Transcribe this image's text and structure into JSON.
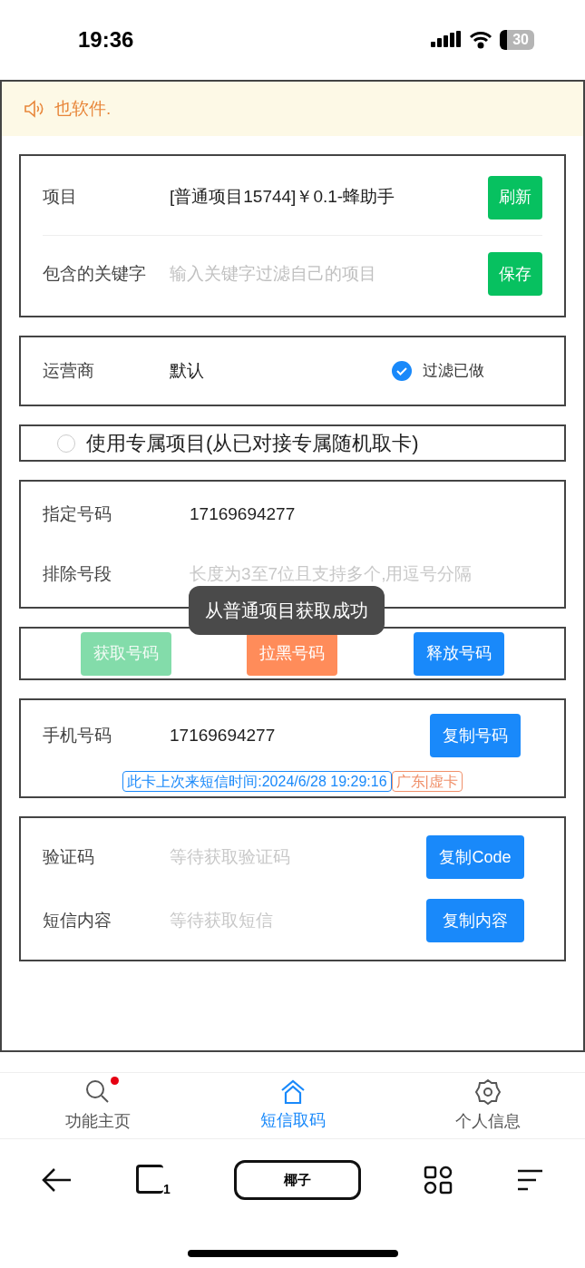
{
  "status_bar": {
    "time": "19:36",
    "battery": "30"
  },
  "notice": {
    "text": "也软件."
  },
  "project_card": {
    "rows": [
      {
        "kind": "value",
        "label": "项目",
        "value": "[普通项目15744]￥0.1-蜂助手",
        "button": "刷新"
      },
      {
        "kind": "input",
        "label": "包含的关键字",
        "placeholder": "输入关键字过滤自己的项目",
        "button": "保存"
      }
    ]
  },
  "carrier_card": {
    "label": "运营商",
    "value": "默认",
    "filter": {
      "label": "过滤已做",
      "checked": true
    }
  },
  "exclusive_option": {
    "label": "使用专属项目(从已对接专属随机取卡)",
    "selected": false
  },
  "number_card": {
    "rows": [
      {
        "kind": "value",
        "label": "指定号码",
        "value": "17169694277"
      },
      {
        "kind": "input",
        "label": "排除号段",
        "placeholder": "长度为3至7位且支持多个,用逗号分隔"
      }
    ]
  },
  "toast": {
    "text": "从普通项目获取成功"
  },
  "actions": [
    {
      "label": "获取号码",
      "color": "#83dcaa",
      "disabled": true
    },
    {
      "label": "拉黑号码",
      "color": "#ff8c5a",
      "disabled": false
    },
    {
      "label": "释放号码",
      "color": "#1989fa",
      "disabled": false
    }
  ],
  "phone_card": {
    "label": "手机号码",
    "value": "17169694277",
    "button": "复制号码",
    "tags": [
      {
        "text": "此卡上次来短信时间:2024/6/28 19:29:16",
        "color": "#1989fa"
      },
      {
        "text": "广东|虚卡",
        "color": "#f0906a"
      }
    ]
  },
  "sms_card": {
    "rows": [
      {
        "kind": "input",
        "label": "验证码",
        "placeholder": "等待获取验证码",
        "button": "复制Code"
      },
      {
        "kind": "input",
        "label": "短信内容",
        "placeholder": "等待获取短信",
        "button": "复制内容"
      }
    ]
  },
  "tabs": [
    {
      "kind": "search",
      "label": "功能主页",
      "selected": false,
      "notification": true
    },
    {
      "kind": "home",
      "label": "短信取码",
      "selected": true,
      "notification": false
    },
    {
      "kind": "settings",
      "label": "个人信息",
      "selected": false,
      "notification": false
    }
  ],
  "browser_bar": {
    "title": "椰子",
    "tab_count": "1"
  }
}
